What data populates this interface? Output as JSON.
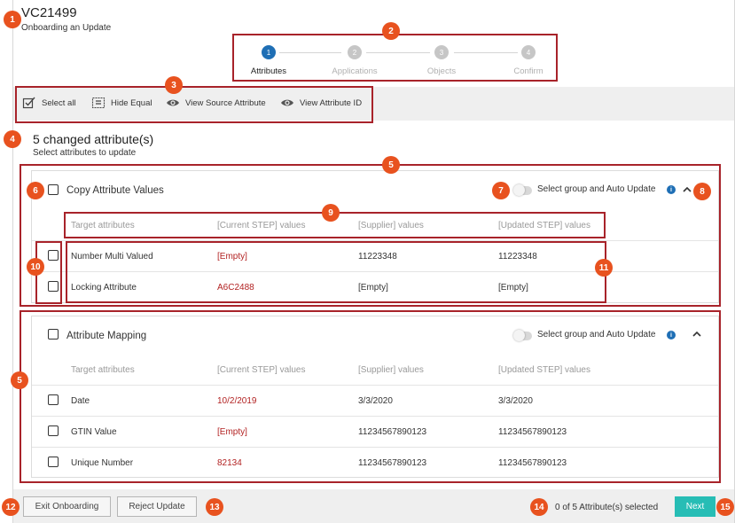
{
  "header": {
    "title": "VC21499",
    "subtitle": "Onboarding an Update"
  },
  "stepper": {
    "steps": [
      {
        "number": "1",
        "label": "Attributes",
        "state": "active"
      },
      {
        "number": "2",
        "label": "Applications",
        "state": "inactive"
      },
      {
        "number": "3",
        "label": "Objects",
        "state": "inactive"
      },
      {
        "number": "4",
        "label": "Confirm",
        "state": "inactive"
      }
    ]
  },
  "toolbar": {
    "select_all": "Select all",
    "hide_equal": "Hide Equal",
    "view_source_attribute": "View Source Attribute",
    "view_attribute_id": "View Attribute ID"
  },
  "summary": {
    "title": "5 changed attribute(s)",
    "subtitle": "Select attributes to update"
  },
  "columns": [
    "Target attributes",
    "[Current STEP] values",
    "[Supplier] values",
    "[Updated STEP] values"
  ],
  "groups": [
    {
      "title": "Copy Attribute Values",
      "auto_update_label": "Select group and Auto Update",
      "rows": [
        {
          "target": "Number Multi Valued",
          "current": "[Empty]",
          "supplier": "11223348",
          "updated": "11223348"
        },
        {
          "target": "Locking Attribute",
          "current": "A6C2488",
          "supplier": "[Empty]",
          "updated": "[Empty]"
        }
      ]
    },
    {
      "title": "Attribute Mapping",
      "auto_update_label": "Select group and Auto Update",
      "rows": [
        {
          "target": "Date",
          "current": "10/2/2019",
          "supplier": "3/3/2020",
          "updated": "3/3/2020"
        },
        {
          "target": "GTIN Value",
          "current": "[Empty]",
          "supplier": "11234567890123",
          "updated": "11234567890123"
        },
        {
          "target": "Unique Number",
          "current": "82134",
          "supplier": "11234567890123",
          "updated": "11234567890123"
        }
      ]
    }
  ],
  "footer": {
    "exit_label": "Exit Onboarding",
    "reject_label": "Reject Update",
    "selection_status": "0 of 5 Attribute(s) selected",
    "next_label": "Next"
  },
  "callouts": [
    "1",
    "2",
    "3",
    "4",
    "5",
    "6",
    "7",
    "8",
    "9",
    "10",
    "11",
    "12",
    "13",
    "14",
    "15",
    "5"
  ],
  "colors": {
    "accent": "#1f6fb5",
    "callout": "#e8521f",
    "highlight": "#a8232a",
    "changed_value": "#b22222",
    "next_button": "#27bdb5"
  }
}
